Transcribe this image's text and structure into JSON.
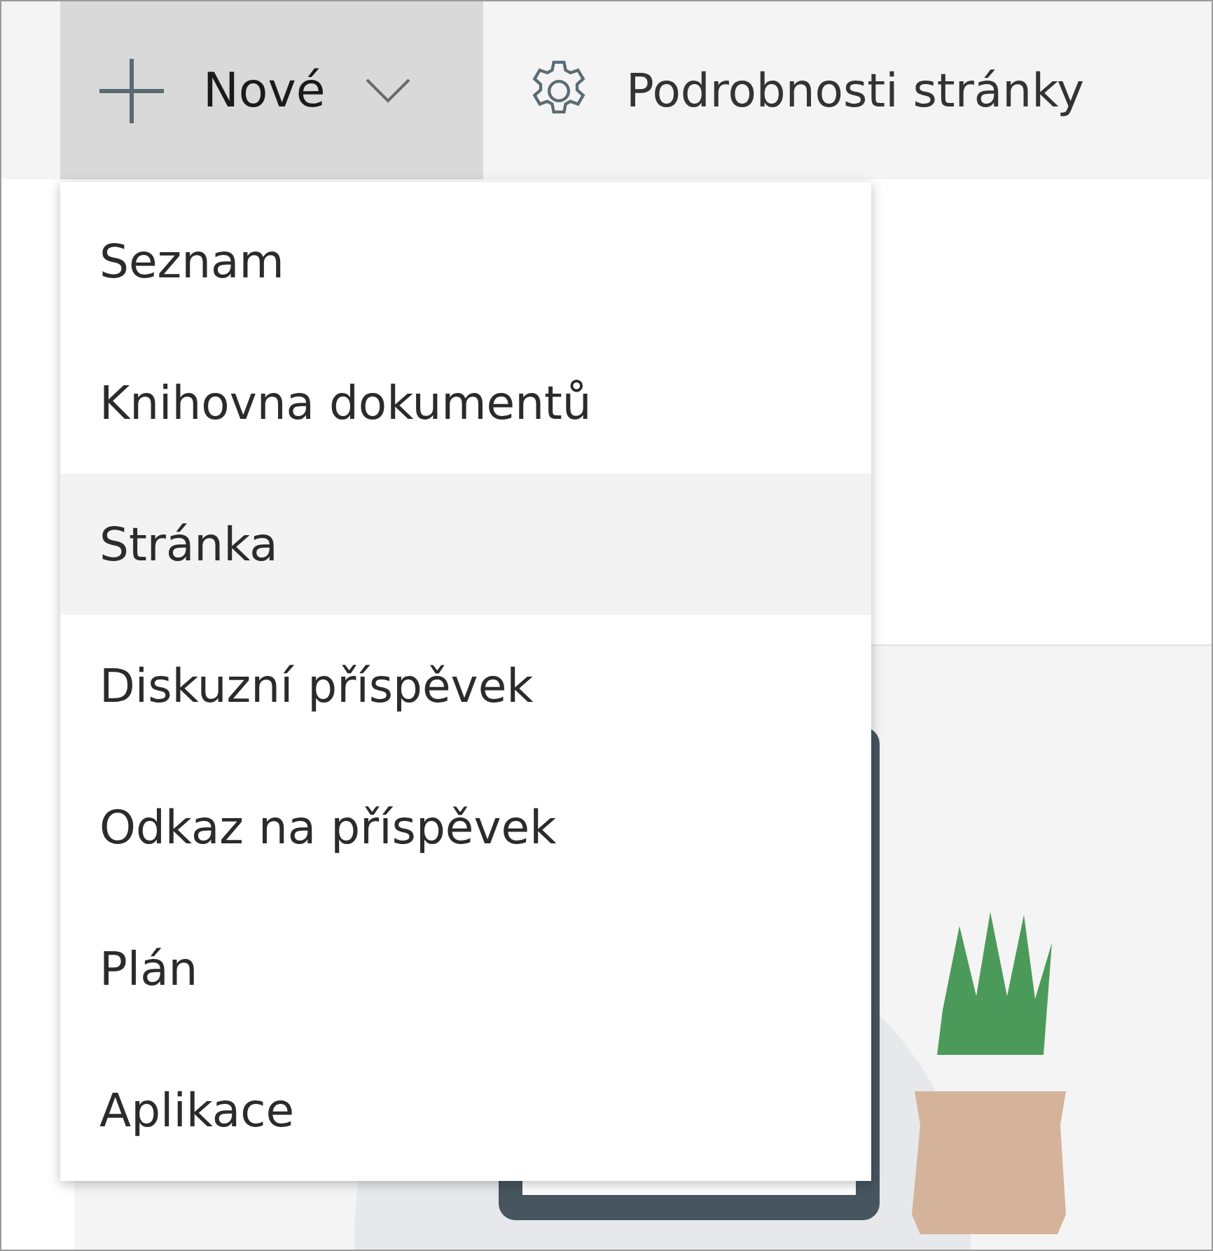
{
  "toolbar": {
    "new_button": {
      "label": "Nové",
      "expanded": true
    },
    "settings_button": {
      "label": "Podrobnosti stránky"
    }
  },
  "new_menu": {
    "items": [
      {
        "label": "Seznam",
        "selected": false
      },
      {
        "label": "Knihovna dokumentů",
        "selected": false
      },
      {
        "label": "Stránka",
        "selected": true
      },
      {
        "label": "Diskuzní příspěvek",
        "selected": false
      },
      {
        "label": "Odkaz na příspěvek",
        "selected": false
      },
      {
        "label": "Plán",
        "selected": false
      },
      {
        "label": "Aplikace",
        "selected": false
      }
    ]
  }
}
